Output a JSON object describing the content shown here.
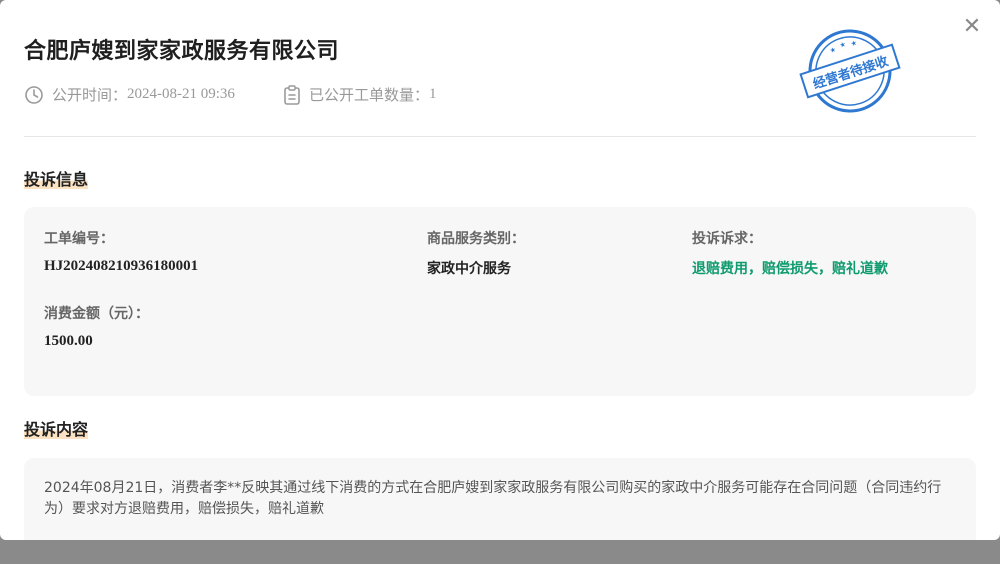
{
  "header": {
    "company_name": "合肥庐嫂到家家政服务有限公司",
    "publish_label": "公开时间：",
    "publish_time": "2024-08-21 09:36",
    "orders_label": "已公开工单数量：",
    "orders_count": "1",
    "stamp_text": "经营者待接收",
    "close_icon": "close-icon"
  },
  "complaint_info": {
    "section_title": "投诉信息",
    "fields": [
      {
        "label": "工单编号：",
        "value": "HJ20240821093618000​1"
      },
      {
        "label": "商品服务类别：",
        "value": "家政中介服务"
      },
      {
        "label": "投诉诉求：",
        "value": "退赔费用，赔偿损失，赔礼道歉"
      },
      {
        "label": "消费金额（元）：",
        "value": "1500.00"
      }
    ]
  },
  "complaint_content": {
    "section_title": "投诉内容",
    "text": "2024年08月21日，消费者李**反映其通过线下消费的方式在合肥庐嫂到家家政服务有限公司购买的家政中介服务可能存在合同问题（合同违约行为）要求对方退赔费用，赔偿损失，赔礼道歉"
  },
  "colors": {
    "accent_green": "#0f9b6e",
    "stamp_blue": "#2f78d1",
    "section_highlight": "#fde3c2"
  }
}
